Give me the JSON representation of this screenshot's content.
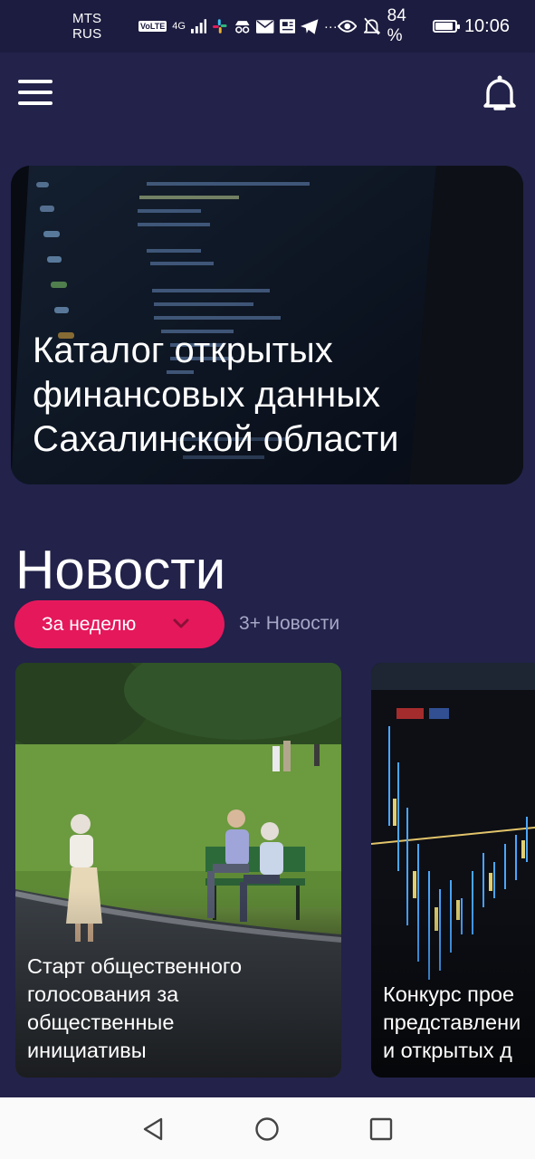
{
  "status_bar": {
    "carrier": "MTS RUS",
    "volte": "VoLTE",
    "network": "4G",
    "battery_percent": "84 %",
    "battery_level": 0.84,
    "time": "10:06",
    "icons": [
      "signal-icon",
      "slack-icon",
      "incognito-icon",
      "mail-icon",
      "news-icon",
      "telegram-icon",
      "more-icon",
      "eye-icon",
      "mute-bell-icon",
      "battery-icon"
    ]
  },
  "header": {
    "menu_icon": "hamburger-menu-icon",
    "notification_icon": "bell-icon"
  },
  "hero": {
    "title": "Каталог открытых финансовых данных Сахалинской области"
  },
  "news": {
    "heading": "Новости",
    "filter_label": "За неделю",
    "count_label": "3+ Новости",
    "cards": [
      {
        "caption": "Старт общественного\nголосования за\nобщественные\nинициативы"
      },
      {
        "caption": "Конкурс прое\nпредставлени\nи открытых д"
      }
    ]
  },
  "colors": {
    "background": "#22224a",
    "status_bar": "#1c1c40",
    "accent": "#e5185c",
    "muted_text": "#a7a7c7",
    "nav_bar": "#fafafa"
  },
  "nav_bar": {
    "buttons": [
      "back-icon",
      "home-icon",
      "recents-icon"
    ]
  }
}
